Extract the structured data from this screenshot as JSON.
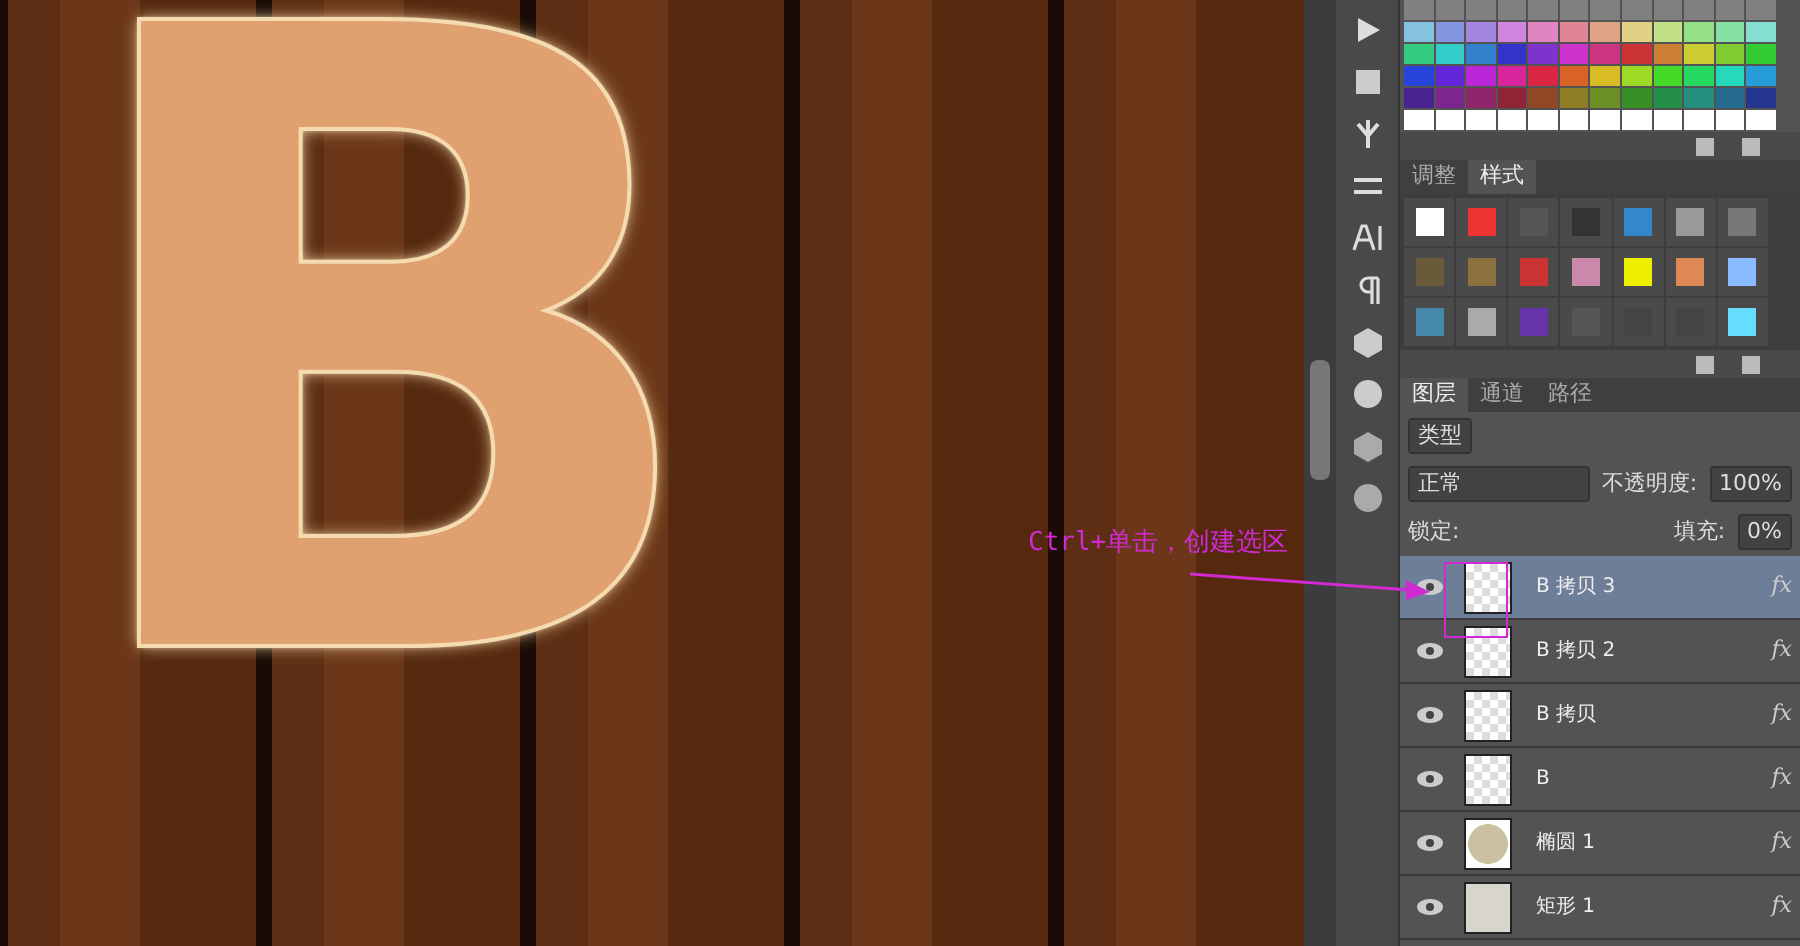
{
  "canvas": {
    "letter": "B"
  },
  "annotation": {
    "text": "Ctrl+单击，创建选区"
  },
  "styles_panel": {
    "tabs": [
      {
        "label": "调整",
        "selected": false
      },
      {
        "label": "样式",
        "selected": true
      }
    ]
  },
  "layers_panel": {
    "tabs": [
      {
        "label": "图层",
        "selected": true
      },
      {
        "label": "通道",
        "selected": false
      },
      {
        "label": "路径",
        "selected": false
      }
    ],
    "filter": "类型",
    "blend_mode": "正常",
    "opacity_label": "不透明度:",
    "opacity": "100%",
    "lock_label": "锁定:",
    "fill_label": "填充:",
    "fill": "0%",
    "layers": [
      {
        "name": "B 拷贝 3",
        "kind": "transparent",
        "selected": true,
        "visible": true,
        "fx": "fx"
      },
      {
        "name": "B 拷贝 2",
        "kind": "transparent",
        "selected": false,
        "visible": true,
        "fx": "fx"
      },
      {
        "name": "B 拷贝",
        "kind": "transparent",
        "selected": false,
        "visible": true,
        "fx": "fx"
      },
      {
        "name": "B",
        "kind": "transparent",
        "selected": false,
        "visible": true,
        "fx": "fx"
      },
      {
        "name": "椭圆 1",
        "kind": "ellipse",
        "selected": false,
        "visible": true,
        "fx": "fx"
      },
      {
        "name": "矩形 1",
        "kind": "rect",
        "selected": false,
        "visible": true,
        "fx": "fx"
      }
    ]
  }
}
